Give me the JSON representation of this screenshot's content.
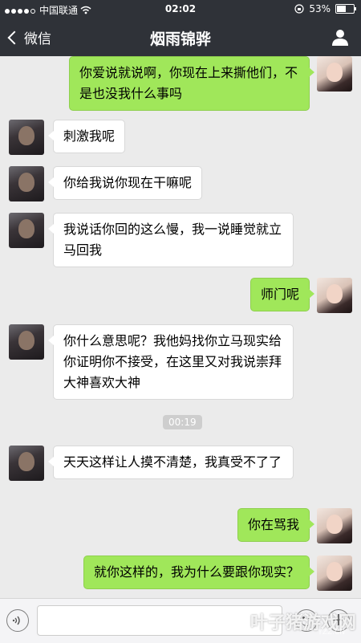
{
  "status_bar": {
    "carrier": "中国联通",
    "time": "02:02",
    "battery": "53%",
    "battery_level": 0.53
  },
  "nav": {
    "back_label": "微信",
    "title": "烟雨锦骅"
  },
  "messages": [
    {
      "sender": "self",
      "text": "你爱说就说啊，你现在上来撕他们，不是也没我什么事吗"
    },
    {
      "sender": "other",
      "text": "刺激我呢"
    },
    {
      "sender": "other",
      "text": "你给我说你现在干嘛呢"
    },
    {
      "sender": "other",
      "text": "我说话你回的这么慢，我一说睡觉就立马回我"
    },
    {
      "sender": "self",
      "text": "师门呢"
    },
    {
      "sender": "other",
      "text": "你什么意思呢？我他妈找你立马现实给你证明你不接受，在这里又对我说崇拜大神喜欢大神"
    },
    {
      "sender": "other",
      "text": "天天这样让人摸不清楚，我真受不了了"
    },
    {
      "sender": "self",
      "text": "你在骂我"
    },
    {
      "sender": "self",
      "text": "就你这样的，我为什么要跟你现实？"
    }
  ],
  "timestamp": "00:19",
  "watermark": {
    "main": "叶子猪游戏网",
    "sub": "YZZ.CN"
  },
  "icons": {
    "back": "chevron-left-icon",
    "profile": "person-icon",
    "voice": "voice-icon",
    "emoji": "emoji-icon",
    "plus": "plus-icon",
    "wifi": "wifi-icon"
  },
  "colors": {
    "nav_bg": "#2f3238",
    "chat_bg": "#ebebeb",
    "self_bubble": "#a0e75a",
    "other_bubble": "#ffffff"
  }
}
